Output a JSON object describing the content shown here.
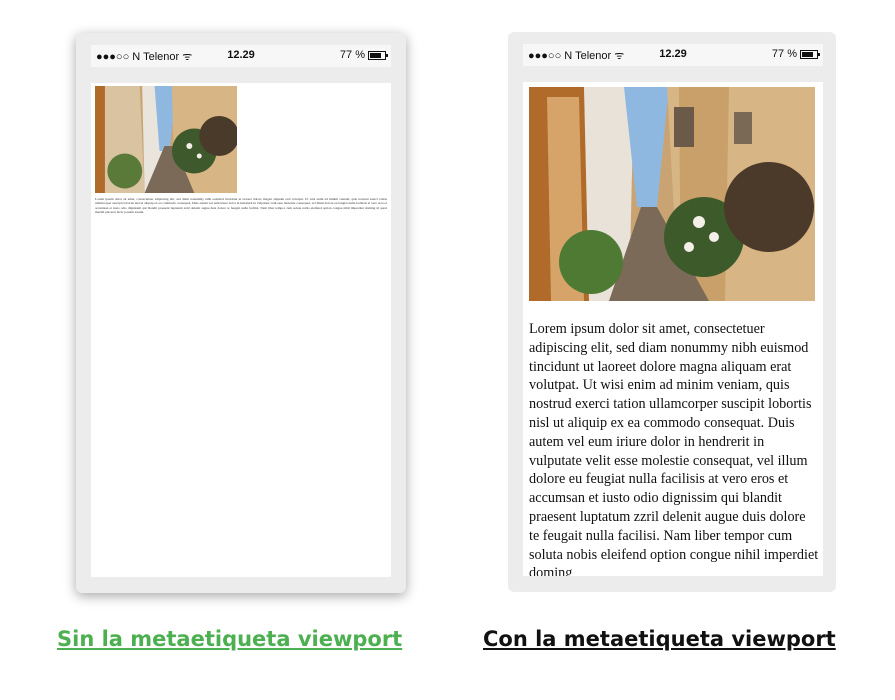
{
  "phones": {
    "left": {
      "status": {
        "carrier": "●●●○○ N Telenor",
        "wifi": "ᯤ",
        "time": "12.29",
        "battery": "77 %"
      },
      "text": "Lorem ipsum dolor sit amet, consectetuer adipiscing elit, sed diam nonummy nibh euismod tincidunt ut laoreet dolore magna aliquam erat volutpat. Ut wisi enim ad minim veniam, quis nostrud exerci tation ullamcorper suscipit lobortis nisl ut aliquip ex ea commodo consequat. Duis autem vel eum iriure dolor in hendrerit in vulputate velit esse molestie consequat, vel illum dolore eu feugiat nulla facilisis at vero eros et accumsan et iusto odio dignissim qui blandit praesent luptatum zzril delenit augue duis dolore te feugait nulla facilisi. Nam liber tempor cum soluta nobis eleifend option congue nihil imperdiet doming id quod mazim placerat facer possim assum."
    },
    "right": {
      "status": {
        "carrier": "●●●○○ N Telenor",
        "wifi": "ᯤ",
        "time": "12.29",
        "battery": "77 %"
      },
      "text": "Lorem ipsum dolor sit amet, consectetuer adipiscing elit, sed diam nonummy nibh euismod tincidunt ut laoreet dolore magna aliquam erat volutpat. Ut wisi enim ad minim veniam, quis nostrud exerci tation ullamcorper suscipit lobortis nisl ut aliquip ex ea commodo consequat. Duis autem vel eum iriure dolor in hendrerit in vulputate velit esse molestie consequat, vel illum dolore eu feugiat nulla facilisis at vero eros et accumsan et iusto odio dignissim qui blandit praesent luptatum zzril delenit augue duis dolore te feugait nulla facilisi. Nam liber tempor cum soluta nobis eleifend option congue nihil imperdiet doming"
    }
  },
  "captions": {
    "left": "Sin la metaetiqueta viewport",
    "right": "Con la metaetiqueta viewport"
  },
  "colors": {
    "left_caption": "#4caf50",
    "right_caption": "#111111"
  }
}
